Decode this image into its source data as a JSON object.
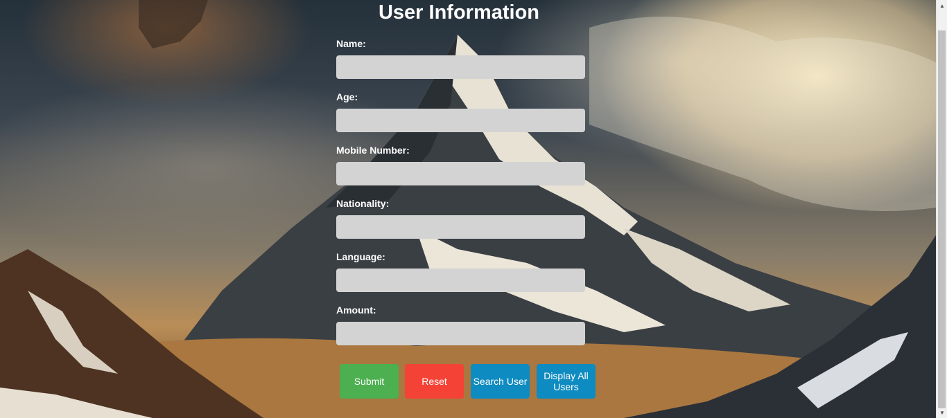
{
  "title": "User Information",
  "fields": [
    {
      "label": "Name:",
      "value": ""
    },
    {
      "label": "Age:",
      "value": ""
    },
    {
      "label": "Mobile Number:",
      "value": ""
    },
    {
      "label": "Nationality:",
      "value": ""
    },
    {
      "label": "Language:",
      "value": ""
    },
    {
      "label": "Amount:",
      "value": ""
    }
  ],
  "buttons": {
    "submit": "Submit",
    "reset": "Reset",
    "search": "Search User",
    "display_all": "Display All Users"
  },
  "colors": {
    "submit": "#4caf50",
    "reset": "#f44336",
    "search": "#0e8bc0",
    "display_all": "#0e8bc0",
    "input_bg": "#d3d3d3"
  }
}
